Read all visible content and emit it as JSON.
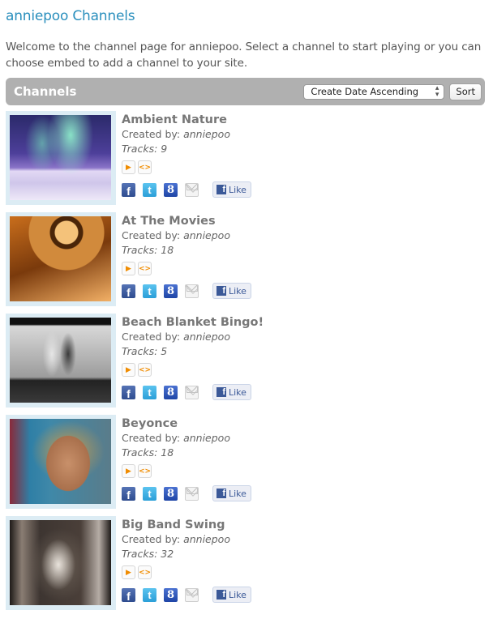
{
  "page": {
    "title": "anniepoo Channels",
    "welcome": "Welcome to the channel page for anniepoo. Select a channel to start playing or you can choose embed to add a channel to your site."
  },
  "toolbar": {
    "heading": "Channels",
    "sort_select_value": "Create Date Ascending",
    "sort_label": "Sort"
  },
  "icons": {
    "play": "▶",
    "embed": "<>",
    "facebook": "f",
    "twitter": "t",
    "google": "8",
    "email": "envelope",
    "like": "Like"
  },
  "channels": [
    {
      "name": "Ambient Nature",
      "created_label": "Created by:",
      "author": "anniepoo",
      "tracks_label": "Tracks:",
      "tracks": "9",
      "like_label": "Like"
    },
    {
      "name": "At The Movies",
      "created_label": "Created by:",
      "author": "anniepoo",
      "tracks_label": "Tracks:",
      "tracks": "18",
      "like_label": "Like"
    },
    {
      "name": "Beach Blanket Bingo!",
      "created_label": "Created by:",
      "author": "anniepoo",
      "tracks_label": "Tracks:",
      "tracks": "5",
      "like_label": "Like"
    },
    {
      "name": "Beyonce",
      "created_label": "Created by:",
      "author": "anniepoo",
      "tracks_label": "Tracks:",
      "tracks": "18",
      "like_label": "Like"
    },
    {
      "name": "Big Band Swing",
      "created_label": "Created by:",
      "author": "anniepoo",
      "tracks_label": "Tracks:",
      "tracks": "32",
      "like_label": "Like"
    }
  ],
  "colors": {
    "title": "#2a8fbd",
    "bar": "#b0b0b0",
    "thumb_frame": "#dcecf4",
    "action_accent": "#f08c00"
  }
}
